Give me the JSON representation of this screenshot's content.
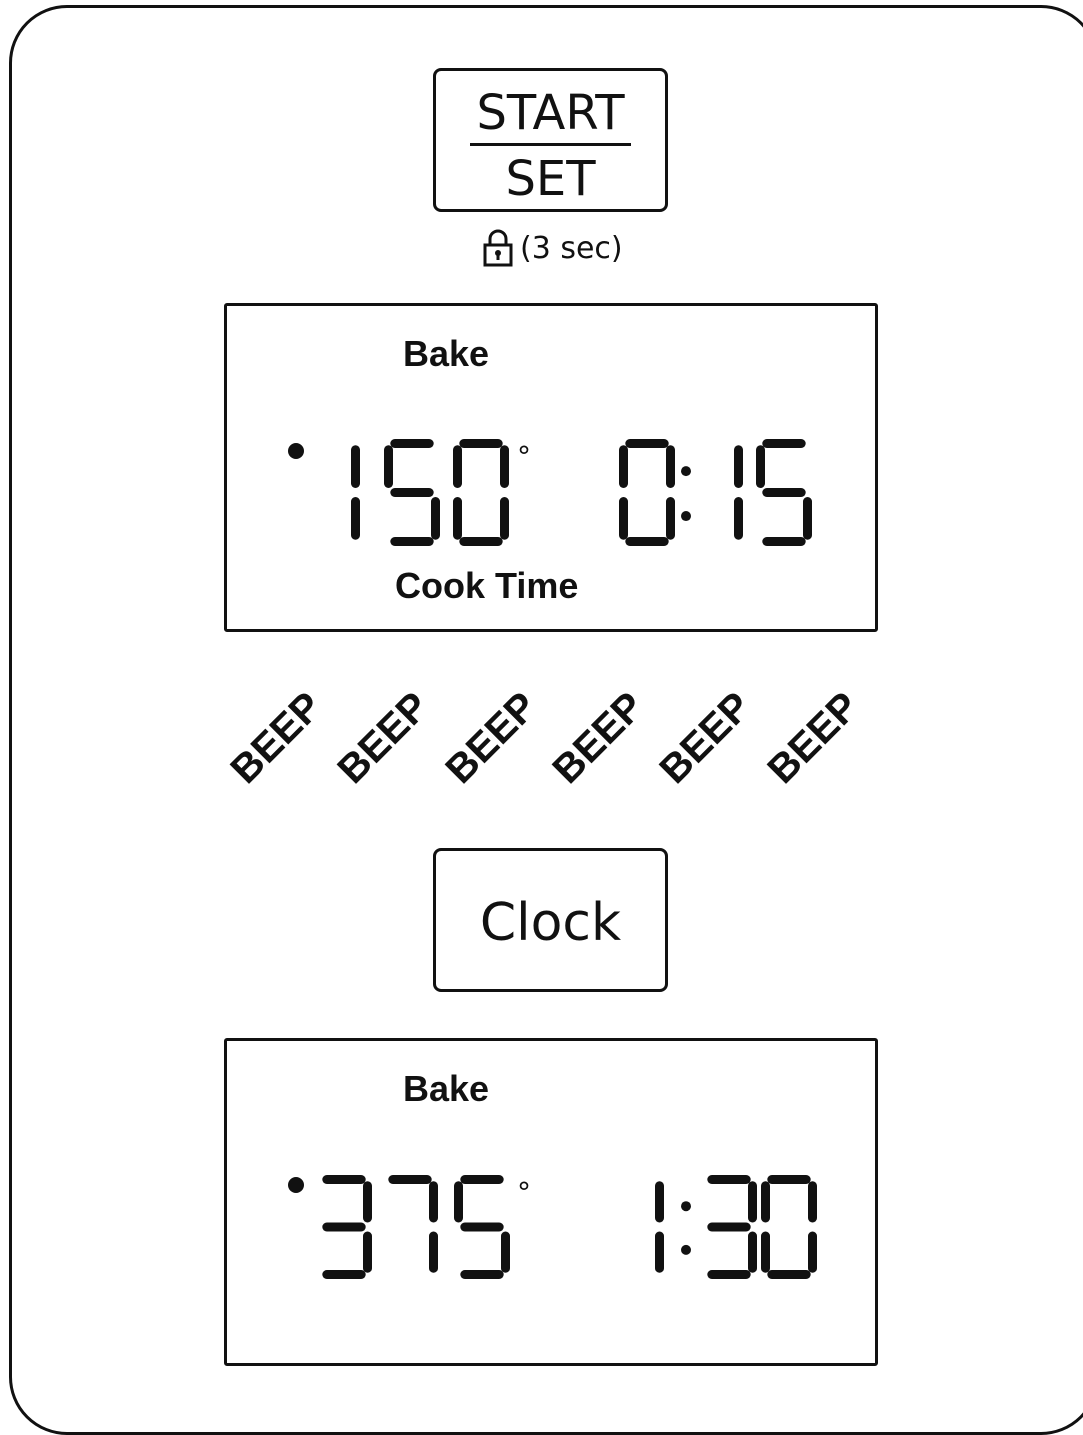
{
  "start_button": {
    "top_label": "START",
    "bottom_label": "SET"
  },
  "lock_hint": {
    "icon": "lock-icon",
    "text": "(3 sec)"
  },
  "display_1": {
    "mode": "Bake",
    "temperature": "150",
    "degree": "°",
    "time": "0:15",
    "sub_label": "Cook Time"
  },
  "beeps": [
    "BEEP",
    "BEEP",
    "BEEP",
    "BEEP",
    "BEEP",
    "BEEP"
  ],
  "clock_button": {
    "label": "Clock"
  },
  "display_2": {
    "mode": "Bake",
    "temperature": "375",
    "degree": "°",
    "time": "1:30"
  }
}
